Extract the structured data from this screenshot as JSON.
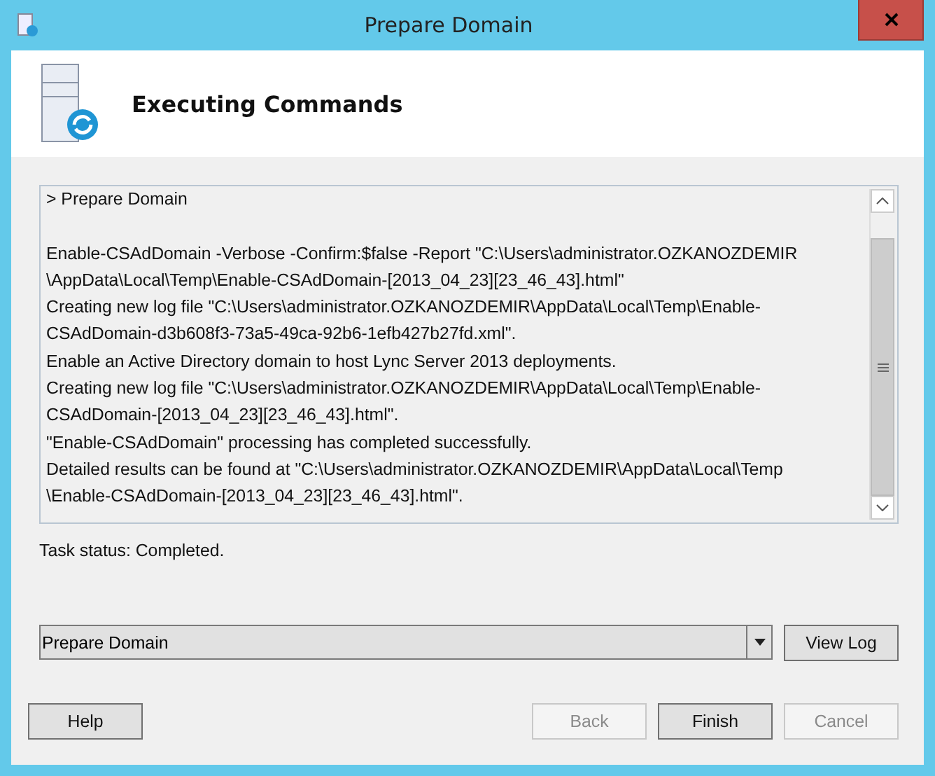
{
  "window": {
    "title": "Prepare Domain"
  },
  "header": {
    "title": "Executing Commands"
  },
  "log": {
    "lines": [
      "> Prepare Domain",
      "Enable-CSAdDomain -Verbose -Confirm:$false -Report \"C:\\Users\\administrator.OZKANOZDEMIR",
      "\\AppData\\Local\\Temp\\Enable-CSAdDomain-[2013_04_23][23_46_43].html\"",
      "Creating new log file \"C:\\Users\\administrator.OZKANOZDEMIR\\AppData\\Local\\Temp\\Enable-",
      "CSAdDomain-d3b608f3-73a5-49ca-92b6-1efb427b27fd.xml\".",
      "Enable an Active Directory domain to host Lync Server 2013 deployments.",
      "Creating new log file \"C:\\Users\\administrator.OZKANOZDEMIR\\AppData\\Local\\Temp\\Enable-",
      "CSAdDomain-[2013_04_23][23_46_43].html\".",
      "\"Enable-CSAdDomain\" processing has completed successfully.",
      "Detailed results can be found at \"C:\\Users\\administrator.OZKANOZDEMIR\\AppData\\Local\\Temp",
      "\\Enable-CSAdDomain-[2013_04_23][23_46_43].html\"."
    ]
  },
  "task_status": "Task status: Completed.",
  "dropdown": {
    "value": "Prepare Domain"
  },
  "view_log_button": {
    "label": "View Log",
    "disabled": false
  },
  "left_buttons": [
    {
      "label": "Help",
      "disabled": false
    }
  ],
  "right_buttons": [
    {
      "label": "Back",
      "disabled": true
    },
    {
      "label": "Finish",
      "disabled": false
    },
    {
      "label": "Cancel",
      "disabled": true
    }
  ]
}
